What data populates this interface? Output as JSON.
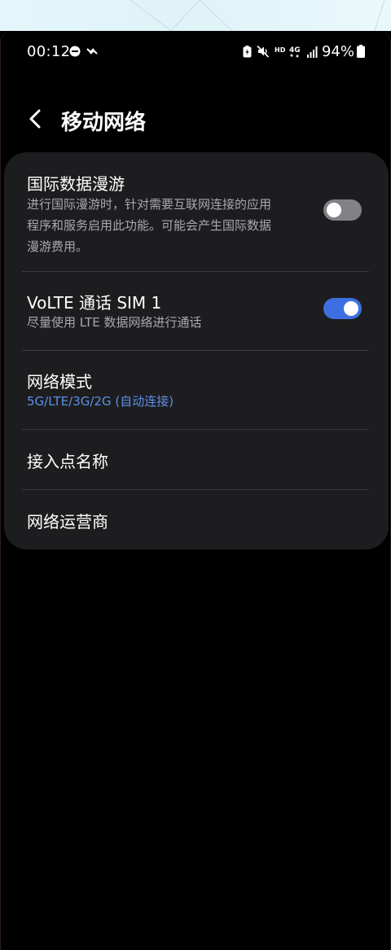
{
  "status_bar": {
    "time": "00:12",
    "battery_percent": "94%",
    "hd_label": "HD",
    "network_label": "4G"
  },
  "header": {
    "title": "移动网络"
  },
  "settings": {
    "intl_roaming": {
      "title": "国际数据漫游",
      "desc_line1": "进行国际漫游时，针对需要互联网连接的应用",
      "desc_line2": "程序和服务启用此功能。可能会产生国际数据",
      "desc_line3": "漫游费用。",
      "enabled": false
    },
    "volte": {
      "title": "VoLTE 通话 SIM 1",
      "desc": "尽量使用 LTE 数据网络进行通话",
      "enabled": true
    },
    "network_mode": {
      "title": "网络模式",
      "value": "5G/LTE/3G/2G (自动连接)"
    },
    "apn": {
      "title": "接入点名称"
    },
    "operator": {
      "title": "网络运营商"
    }
  },
  "colors": {
    "accent": "#3e6fe0",
    "accent_text": "#5f8fe8",
    "card_bg": "#1d1d1f",
    "toggle_off": "#828286"
  }
}
